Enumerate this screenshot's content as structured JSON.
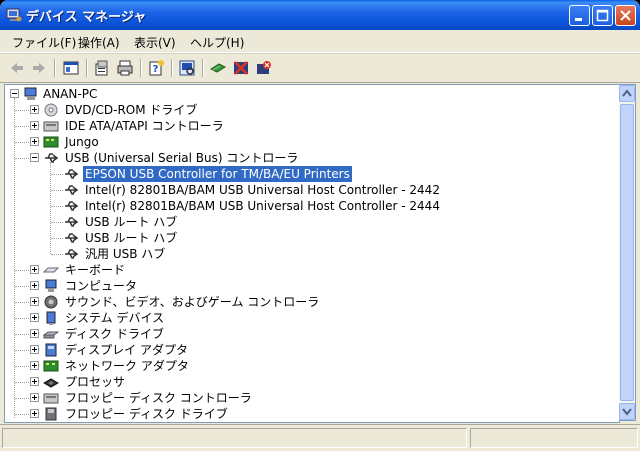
{
  "window": {
    "title": "デバイス マネージャ"
  },
  "menu": [
    "ファイル(F)",
    "操作(A)",
    "表示(V)",
    "ヘルプ(H)"
  ],
  "toolbar": [
    "back-icon",
    "forward-icon",
    "properties-panel-icon",
    "properties-icon",
    "print-icon",
    "help-icon",
    "scan-hardware-icon",
    "update-driver-icon",
    "disable-device-icon",
    "uninstall-icon"
  ],
  "tree": {
    "root": "ANAN-PC",
    "items": [
      {
        "label": "DVD/CD-ROM ドライブ",
        "icon": "dvd-drive-icon",
        "expanded": false
      },
      {
        "label": "IDE ATA/ATAPI コントローラ",
        "icon": "ide-controller-icon",
        "expanded": false
      },
      {
        "label": "Jungo",
        "icon": "jungo-icon",
        "expanded": false
      },
      {
        "label": "USB (Universal Serial Bus) コントローラ",
        "icon": "usb-icon",
        "expanded": true,
        "children": [
          {
            "label": "EPSON USB Controller for TM/BA/EU Printers",
            "selected": true
          },
          {
            "label": "Intel(r) 82801BA/BAM USB Universal Host Controller - 2442"
          },
          {
            "label": "Intel(r) 82801BA/BAM USB Universal Host Controller - 2444"
          },
          {
            "label": "USB ルート ハブ"
          },
          {
            "label": "USB ルート ハブ"
          },
          {
            "label": "汎用 USB ハブ"
          }
        ]
      },
      {
        "label": "キーボード",
        "icon": "keyboard-icon",
        "expanded": false
      },
      {
        "label": "コンピュータ",
        "icon": "computer-icon",
        "expanded": false
      },
      {
        "label": "サウンド、ビデオ、およびゲーム コントローラ",
        "icon": "sound-icon",
        "expanded": false
      },
      {
        "label": "システム デバイス",
        "icon": "system-device-icon",
        "expanded": false
      },
      {
        "label": "ディスク ドライブ",
        "icon": "disk-drive-icon",
        "expanded": false
      },
      {
        "label": "ディスプレイ アダプタ",
        "icon": "display-adapter-icon",
        "expanded": false
      },
      {
        "label": "ネットワーク アダプタ",
        "icon": "network-adapter-icon",
        "expanded": false
      },
      {
        "label": "プロセッサ",
        "icon": "processor-icon",
        "expanded": false
      },
      {
        "label": "フロッピー ディスク コントローラ",
        "icon": "floppy-controller-icon",
        "expanded": false
      },
      {
        "label": "フロッピー ディスク ドライブ",
        "icon": "floppy-drive-icon",
        "expanded": false
      }
    ]
  }
}
